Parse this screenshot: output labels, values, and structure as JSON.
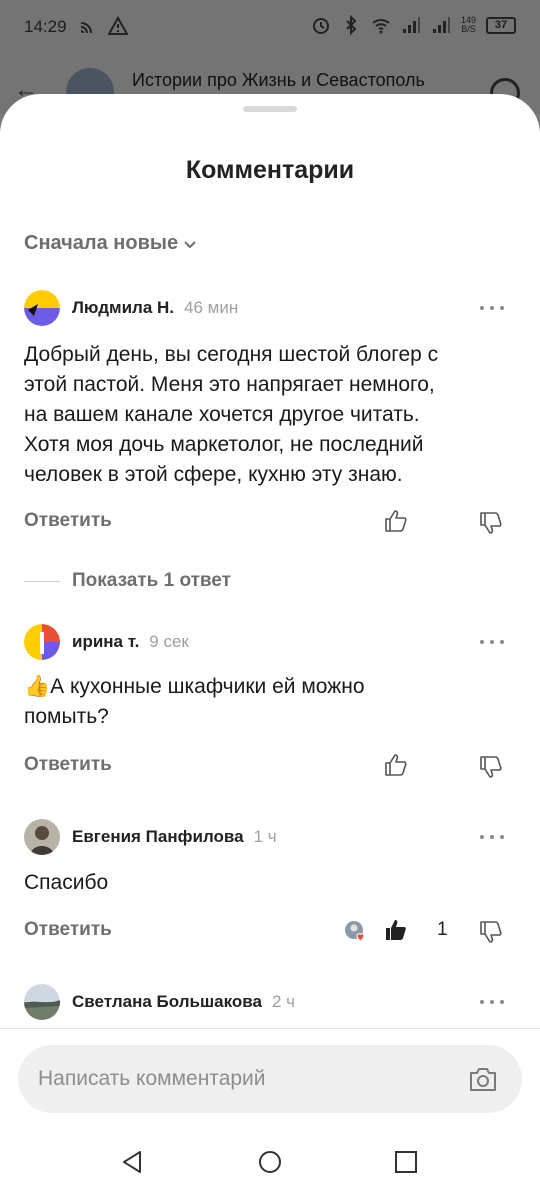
{
  "status_bar": {
    "time": "14:29",
    "speed_value": "149",
    "speed_unit": "B/S",
    "battery": "37",
    "icons": [
      "cast-icon",
      "warning-icon",
      "alarm-icon",
      "bluetooth-icon",
      "wifi-icon",
      "signal-icon",
      "signal-icon"
    ]
  },
  "background_header": {
    "title": "Истории про Жизнь и Севастополь"
  },
  "sheet": {
    "title": "Комментарии",
    "sort_label": "Сначала новые"
  },
  "comments": [
    {
      "author": "Людмила Н.",
      "time": "46 мин",
      "text_lines": [
        "Добрый  день, вы сегодня шестой блогер с",
        "этой пастой. Меня это напрягает немного,",
        "на вашем канале хочется другое читать.",
        "Хотя моя дочь маркетолог, не последний",
        "человек в этой сфере, кухню эту знаю."
      ],
      "reply_label": "Ответить",
      "show_replies_label": "Показать 1 ответ"
    },
    {
      "author": "ирина т.",
      "time": "9 сек",
      "text_lines": [
        "👍А кухонные шкафчики ей можно",
        "помыть?"
      ],
      "reply_label": "Ответить"
    },
    {
      "author": "Евгения Панфилова",
      "time": "1 ч",
      "text_lines": [
        "Спасибо"
      ],
      "reply_label": "Ответить",
      "like_count": "1"
    },
    {
      "author": "Светлана Большакова",
      "time": "2 ч"
    }
  ],
  "composer": {
    "placeholder": "Написать комментарий"
  },
  "colors": {
    "accent_yellow": "#ffcc00",
    "accent_purple": "#6c5ce7",
    "reaction_red": "#e8503a"
  }
}
